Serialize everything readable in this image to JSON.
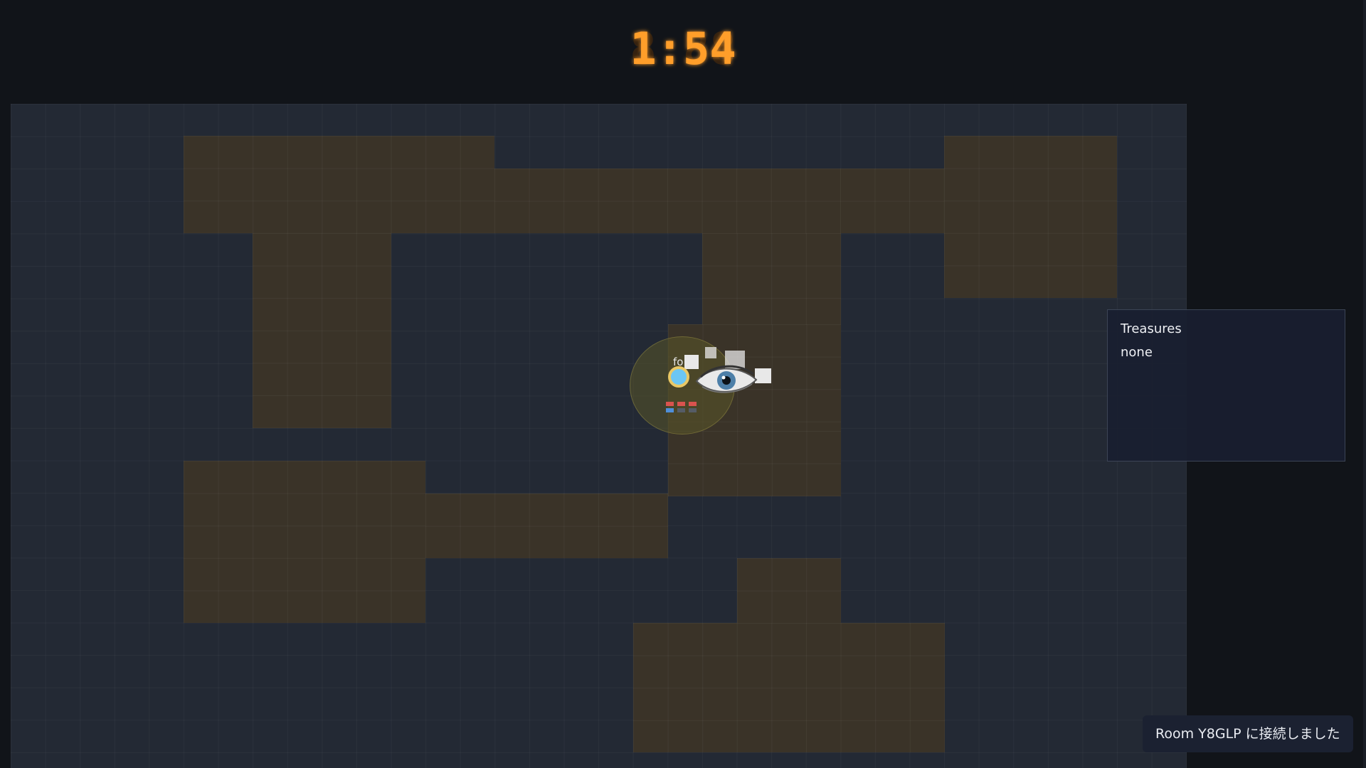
{
  "timer": {
    "display": "1:54",
    "color": "#ff9e2c"
  },
  "player": {
    "name": "fo",
    "color": "#6cc6f3",
    "ring_color": "#e9c866"
  },
  "icons": {
    "vision": "eye-icon"
  },
  "treasures": {
    "title": "Treasures",
    "value": "none"
  },
  "toast": {
    "message": "Room Y8GLP に接続しました"
  },
  "colors": {
    "wall": "#232934",
    "floor": "#3a3328",
    "background": "#111419"
  }
}
